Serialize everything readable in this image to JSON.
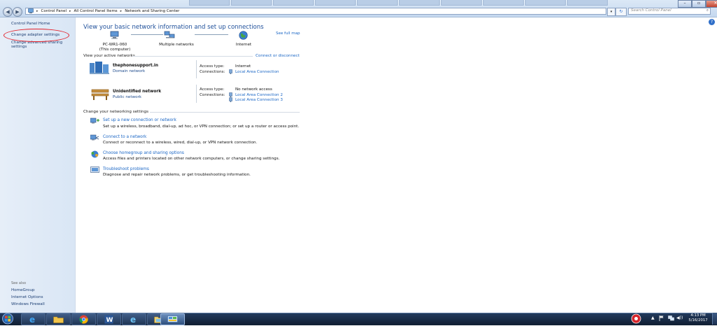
{
  "address_bar": {
    "crumbs": [
      "Control Panel",
      "All Control Panel Items",
      "Network and Sharing Center"
    ],
    "search_placeholder": "Search Control Panel"
  },
  "left_panel": {
    "home": "Control Panel Home",
    "adapter": "Change adapter settings",
    "sharing": "Change advanced sharing settings",
    "see_also_title": "See also",
    "see_also": [
      "HomeGroup",
      "Internet Options",
      "Windows Firewall"
    ]
  },
  "main": {
    "title": "View your basic network information and set up connections",
    "see_full_map": "See full map",
    "map_nodes": {
      "computer": "PC-WR1-060",
      "computer_sub": "(This computer)",
      "multiple": "Multiple networks",
      "internet": "Internet"
    },
    "active_heading": "View your active networks",
    "connect_disconnect": "Connect or disconnect",
    "networks": [
      {
        "name": "thephonesupport.in",
        "type": "Domain network",
        "access_label": "Access type:",
        "access_value": "Internet",
        "connections_label": "Connections:",
        "connections": [
          "Local Area Connection"
        ]
      },
      {
        "name": "Unidentified network",
        "type": "Public network",
        "access_label": "Access type:",
        "access_value": "No network access",
        "connections_label": "Connections:",
        "connections": [
          "Local Area Connection 2",
          "Local Area Connection 3"
        ]
      }
    ],
    "change_heading": "Change your networking settings",
    "tasks": [
      {
        "title": "Set up a new connection or network",
        "desc": "Set up a wireless, broadband, dial-up, ad hoc, or VPN connection; or set up a router or access point."
      },
      {
        "title": "Connect to a network",
        "desc": "Connect or reconnect to a wireless, wired, dial-up, or VPN network connection."
      },
      {
        "title": "Choose homegroup and sharing options",
        "desc": "Access files and printers located on other network computers, or change sharing settings."
      },
      {
        "title": "Troubleshoot problems",
        "desc": "Diagnose and repair network problems, or get troubleshooting information."
      }
    ]
  },
  "taskbar": {
    "time": "4:13 PM",
    "date": "5/16/2017"
  },
  "colors": {
    "link": "#1a66c5",
    "title": "#1e4f9a",
    "annotation_circle": "#e3212b"
  }
}
